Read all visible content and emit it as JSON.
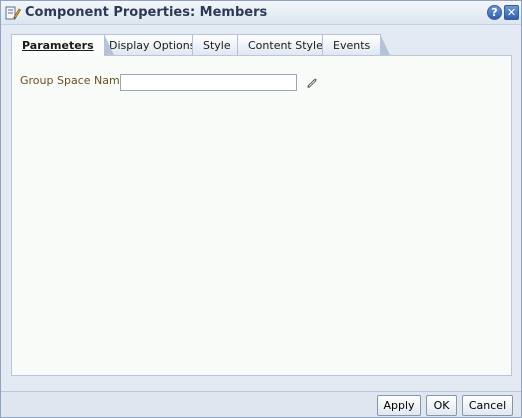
{
  "window": {
    "title": "Component Properties: Members",
    "help_label": "?",
    "close_label": "✕"
  },
  "tabs": [
    {
      "label": "Parameters",
      "active": true
    },
    {
      "label": "Display Options",
      "active": false
    },
    {
      "label": "Style",
      "active": false
    },
    {
      "label": "Content Style",
      "active": false
    },
    {
      "label": "Events",
      "active": false
    }
  ],
  "parameters": {
    "group_space_name_label": "Group Space Name",
    "group_space_name_value": ""
  },
  "footer": {
    "apply_label": "Apply",
    "ok_label": "OK",
    "cancel_label": "Cancel"
  },
  "icons": {
    "title": "component-properties-icon",
    "edit": "pencil-icon"
  }
}
